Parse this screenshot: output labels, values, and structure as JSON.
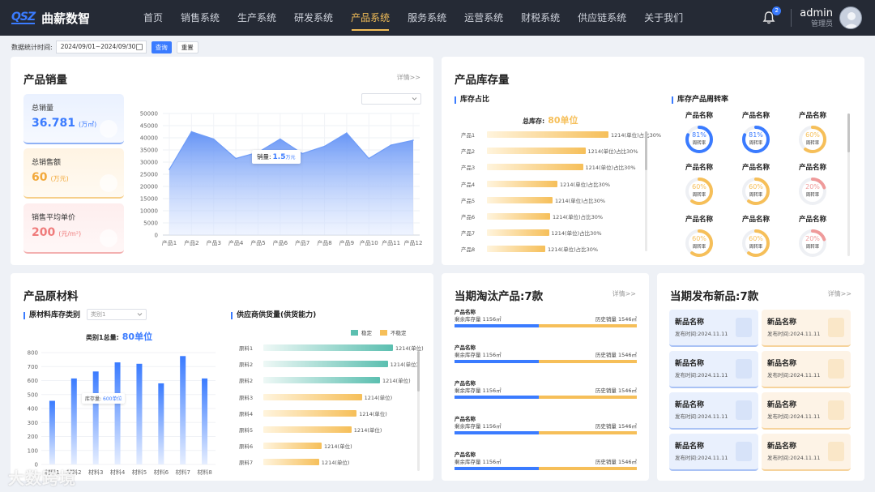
{
  "app": {
    "logo_mark": "QSZ",
    "name": "曲薪数智"
  },
  "nav": {
    "items": [
      {
        "label": "首页"
      },
      {
        "label": "销售系统"
      },
      {
        "label": "生产系统"
      },
      {
        "label": "研发系统"
      },
      {
        "label": "产品系统",
        "active": true
      },
      {
        "label": "服务系统"
      },
      {
        "label": "运营系统"
      },
      {
        "label": "财税系统"
      },
      {
        "label": "供应链系统"
      },
      {
        "label": "关于我们"
      }
    ]
  },
  "header": {
    "notification_count": "2",
    "user_name": "admin",
    "user_role": "管理员"
  },
  "filter": {
    "label": "数据统计时间:",
    "date_range": "2024/09/01~2024/09/30",
    "query_label": "查询",
    "reset_label": "重置"
  },
  "colors": {
    "accent": "#3a7bff",
    "nav_active": "#f2bd58",
    "orange": "#f6bf59",
    "teal": "#5bbfb0",
    "pink": "#ef9a9a"
  },
  "sales": {
    "title": "产品销量",
    "detail": "详情>>",
    "select_value": "",
    "stats": [
      {
        "label": "总销量",
        "value": "36.781",
        "unit": "(万㎡)",
        "icon": "money-bag-icon"
      },
      {
        "label": "总销售额",
        "value": "60",
        "unit": "(万元)",
        "icon": "house-icon"
      },
      {
        "label": "销售平均单价",
        "value": "200",
        "unit": "(元/m²)",
        "icon": "yuan-coin-icon"
      }
    ],
    "tooltip": {
      "label": "销量:",
      "value": "1.5",
      "unit": "万元"
    }
  },
  "chart_data": [
    {
      "type": "area",
      "categories": [
        "产品1",
        "产品2",
        "产品3",
        "产品4",
        "产品5",
        "产品6",
        "产品7",
        "产品8",
        "产品9",
        "产品10",
        "产品11",
        "产品12"
      ],
      "series": [
        {
          "values": [
            27000,
            42500,
            39500,
            31500,
            34000,
            39500,
            33500,
            36500,
            42000,
            31500,
            37000,
            39000
          ]
        }
      ],
      "ylim": [
        0,
        50000
      ],
      "yticks": [
        0,
        5000,
        10000,
        15000,
        20000,
        25000,
        30000,
        35000,
        40000,
        45000,
        50000
      ],
      "color": "#6f9cf7"
    },
    {
      "type": "bar",
      "title": "库存占比",
      "summary_label": "总库存:",
      "summary_value": "80单位",
      "categories": [
        "产品1",
        "产品2",
        "产品3",
        "产品4",
        "产品5",
        "产品6",
        "产品7",
        "产品8"
      ],
      "values": [
        100,
        81,
        79,
        58,
        54,
        52,
        51,
        48
      ],
      "value_labels": [
        "1214(单位)占比30%",
        "1214(单位)占比30%",
        "1214(单位)占比30%",
        "1214(单位)占比30%",
        "1214(单位)占比30%",
        "1214(单位)占比30%",
        "1214(单位)占比30%",
        "1214(单位)占比30%"
      ]
    },
    {
      "type": "bar",
      "title": "原材料库存类别",
      "select_value": "类别1",
      "summary_label": "类别1总量:",
      "summary_value": "80单位",
      "categories": [
        "材料1",
        "材料2",
        "材料3",
        "材料4",
        "材料5",
        "材料6",
        "材料7",
        "材料8"
      ],
      "values": [
        455,
        615,
        665,
        730,
        720,
        580,
        775,
        615
      ],
      "ylim": [
        0,
        800
      ],
      "yticks": [
        0,
        100,
        200,
        300,
        400,
        500,
        600,
        700,
        800
      ],
      "tooltip": {
        "label": "库存量:",
        "value": "600单位"
      }
    },
    {
      "type": "bar",
      "title": "供应商供货量(供货能力)",
      "legend": [
        "稳定",
        "不稳定"
      ],
      "categories": [
        "原料1",
        "原料2",
        "原料2",
        "原料3",
        "原料4",
        "原料5",
        "原料6",
        "原料7"
      ],
      "values": [
        100,
        96,
        90,
        76,
        72,
        68,
        45,
        43
      ],
      "status": [
        "稳定",
        "稳定",
        "稳定",
        "不稳定",
        "不稳定",
        "不稳定",
        "不稳定",
        "不稳定"
      ],
      "value_labels": [
        "1214(单位)",
        "1214(单位)",
        "1214(单位)",
        "1214(单位)",
        "1214(单位)",
        "1214(单位)",
        "1214(单位)",
        "1214(单位)"
      ]
    }
  ],
  "inventory": {
    "title": "产品库存量",
    "turnover_title": "库存产品周转率",
    "rings": [
      {
        "name": "产品名称",
        "pct": "81%",
        "sub": "周转率",
        "value": 0.81,
        "color": "#3a7bff"
      },
      {
        "name": "产品名称",
        "pct": "81%",
        "sub": "周转率",
        "value": 0.81,
        "color": "#3a7bff"
      },
      {
        "name": "产品名称",
        "pct": "60%",
        "sub": "周转率",
        "value": 0.6,
        "color": "#f6bf59"
      },
      {
        "name": "产品名称",
        "pct": "60%",
        "sub": "周转率",
        "value": 0.6,
        "color": "#f6bf59"
      },
      {
        "name": "产品名称",
        "pct": "60%",
        "sub": "周转率",
        "value": 0.6,
        "color": "#f6bf59"
      },
      {
        "name": "产品名称",
        "pct": "20%",
        "sub": "周转率",
        "value": 0.2,
        "color": "#ef9a9a"
      },
      {
        "name": "产品名称",
        "pct": "60%",
        "sub": "周转率",
        "value": 0.6,
        "color": "#f6bf59"
      },
      {
        "name": "产品名称",
        "pct": "60%",
        "sub": "周转率",
        "value": 0.6,
        "color": "#f6bf59"
      },
      {
        "name": "产品名称",
        "pct": "20%",
        "sub": "周转率",
        "value": 0.2,
        "color": "#ef9a9a"
      }
    ]
  },
  "materials": {
    "title": "产品原材料"
  },
  "discontinued": {
    "title": "当期淘汰产品:7款",
    "detail": "详情>>",
    "items": [
      {
        "name": "产品名称",
        "stock": "剩余库存量 1156㎡",
        "sales": "历史销量 1546㎡",
        "ratio": 0.46
      },
      {
        "name": "产品名称",
        "stock": "剩余库存量 1156㎡",
        "sales": "历史销量 1546㎡",
        "ratio": 0.46
      },
      {
        "name": "产品名称",
        "stock": "剩余库存量 1156㎡",
        "sales": "历史销量 1546㎡",
        "ratio": 0.46
      },
      {
        "name": "产品名称",
        "stock": "剩余库存量 1156㎡",
        "sales": "历史销量 1546㎡",
        "ratio": 0.46
      },
      {
        "name": "产品名称",
        "stock": "剩余库存量 1156㎡",
        "sales": "历史销量 1546㎡",
        "ratio": 0.46
      }
    ]
  },
  "new_products": {
    "title": "当期发布新品:7款",
    "detail": "详情>>",
    "items": [
      {
        "name": "新品名称",
        "date": "发布时间:2024.11.11",
        "tone": "blue"
      },
      {
        "name": "新品名称",
        "date": "发布时间:2024.11.11",
        "tone": "orange"
      },
      {
        "name": "新品名称",
        "date": "发布时间:2024.11.11",
        "tone": "blue"
      },
      {
        "name": "新品名称",
        "date": "发布时间:2024.11.11",
        "tone": "orange"
      },
      {
        "name": "新品名称",
        "date": "发布时间:2024.11.11",
        "tone": "blue"
      },
      {
        "name": "新品名称",
        "date": "发布时间:2024.11.11",
        "tone": "orange"
      },
      {
        "name": "新品名称",
        "date": "发布时间:2024.11.11",
        "tone": "blue"
      },
      {
        "name": "新品名称",
        "date": "发布时间:2024.11.11",
        "tone": "orange"
      }
    ]
  },
  "watermark": "大数跨境"
}
